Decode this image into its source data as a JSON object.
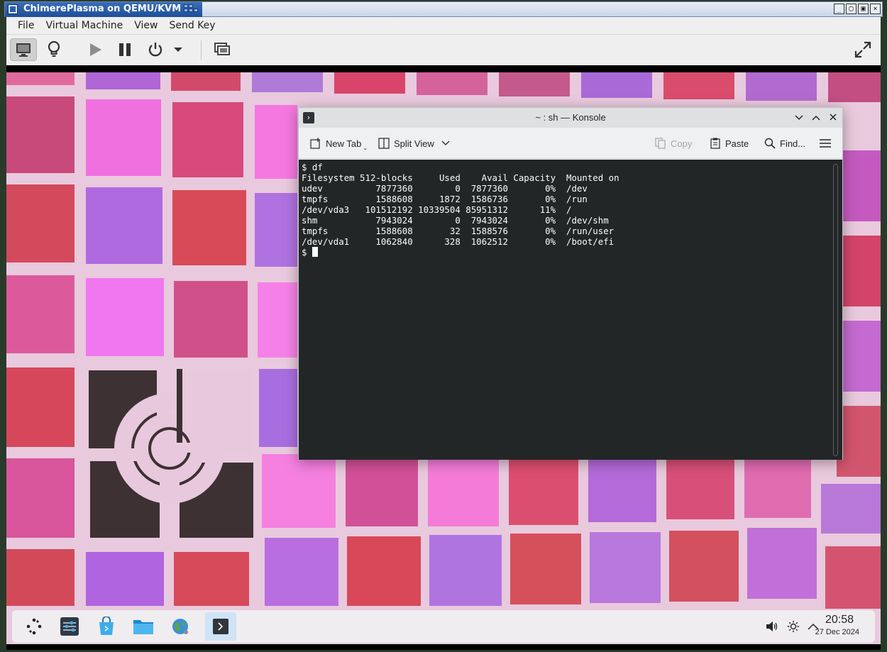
{
  "host": {
    "title": "ChimerePlasma on QEMU/KVM",
    "window_buttons": [
      "_",
      "▢",
      "▣",
      "×"
    ]
  },
  "vm": {
    "menu": [
      "File",
      "Virtual Machine",
      "View",
      "Send Key"
    ],
    "toolbar": {
      "console": "monitor-icon",
      "details": "lightbulb-icon",
      "run": "play-icon",
      "pause": "pause-icon",
      "shutdown": "power-icon",
      "shutdown_menu": "chevron-down-icon",
      "snapshots": "snapshot-icon",
      "fullscreen": "fullscreen-icon"
    }
  },
  "konsole": {
    "title": "~ : sh — Konsole",
    "toolbar": {
      "new_tab": "New Tab",
      "split_view": "Split View",
      "copy": "Copy",
      "paste": "Paste",
      "find": "Find..."
    },
    "terminal_lines": [
      "$ df",
      "Filesystem 512-blocks     Used    Avail Capacity  Mounted on",
      "udev          7877360        0  7877360       0%  /dev",
      "tmpfs         1588608     1872  1586736       0%  /run",
      "/dev/vda3   101512192 10339504 85951312      11%  /",
      "shm           7943024        0  7943024       0%  /dev/shm",
      "tmpfs         1588608       32  1588576       0%  /run/user",
      "/dev/vda1     1062840      328  1062512       0%  /boot/efi"
    ],
    "prompt": "$ "
  },
  "panel": {
    "launchers": [
      "app-launcher-icon",
      "system-settings-icon",
      "discover-icon",
      "dolphin-icon",
      "browser-icon",
      "konsole-icon"
    ],
    "tray": [
      "volume-icon",
      "brightness-icon",
      "chevron-up-icon"
    ],
    "clock_time": "20:58",
    "clock_date": "27 Dec 2024"
  },
  "colors": {
    "accent": "#3daee9",
    "terminal_bg": "#232627",
    "terminal_fg": "#fcfcfc"
  }
}
